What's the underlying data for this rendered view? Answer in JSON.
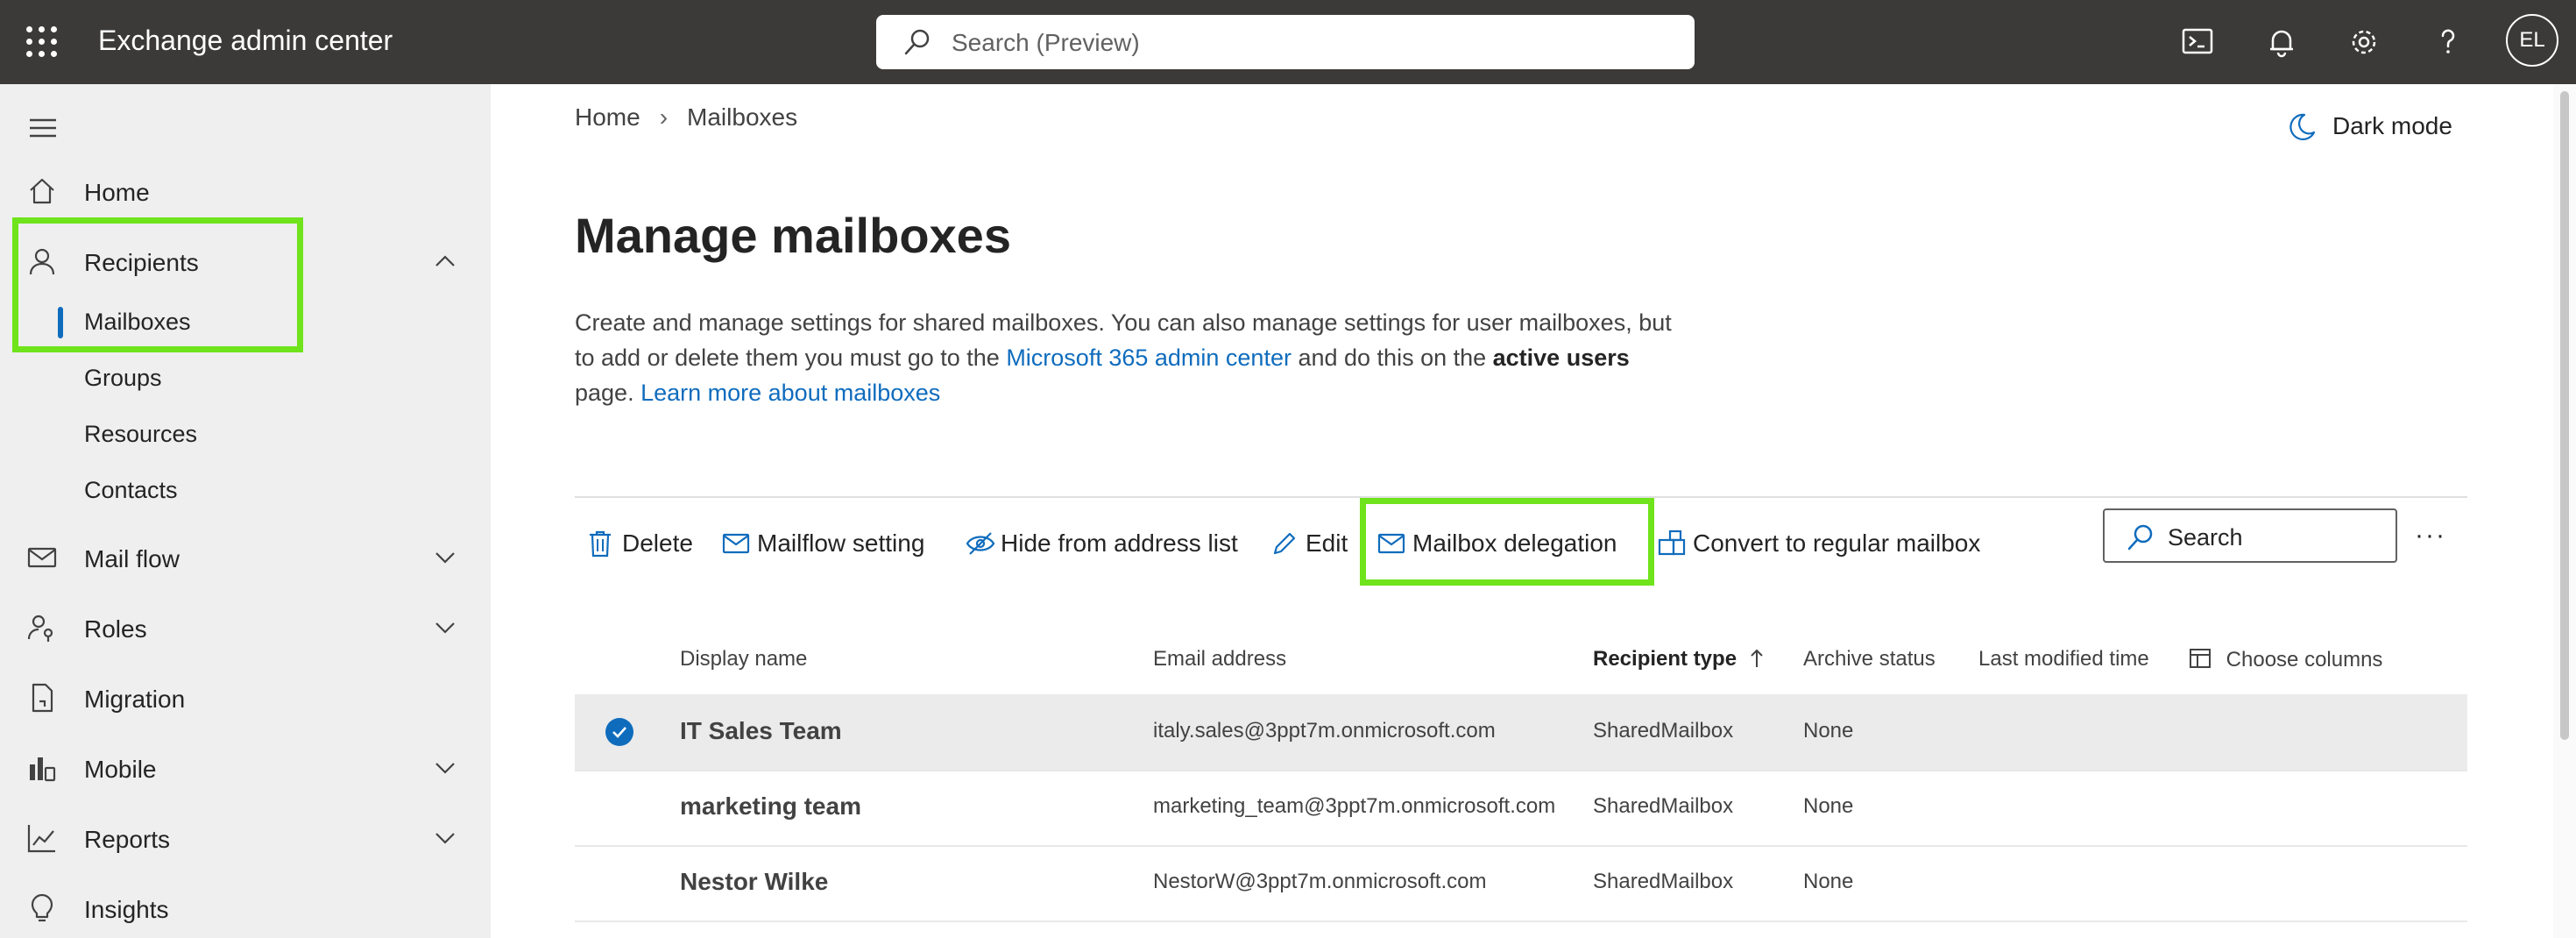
{
  "header": {
    "app_title": "Exchange admin center",
    "search_placeholder": "Search (Preview)",
    "avatar_initials": "EL"
  },
  "sidebar": {
    "items": [
      {
        "label": "Home"
      },
      {
        "label": "Recipients"
      },
      {
        "label": "Mail flow"
      },
      {
        "label": "Roles"
      },
      {
        "label": "Migration"
      },
      {
        "label": "Mobile"
      },
      {
        "label": "Reports"
      },
      {
        "label": "Insights"
      }
    ],
    "recipients_sub": [
      "Mailboxes",
      "Groups",
      "Resources",
      "Contacts"
    ]
  },
  "main": {
    "breadcrumb": [
      "Home",
      "Mailboxes"
    ],
    "dark_mode_label": "Dark mode",
    "title": "Manage mailboxes",
    "desc_part1": "Create and manage settings for shared mailboxes. You can also manage settings for user mailboxes, but to add or delete them you must go to the ",
    "desc_link1": "Microsoft 365 admin center",
    "desc_part2": " and do this on the ",
    "desc_bold": "active users",
    "desc_part3": " page. ",
    "desc_link2": "Learn more about mailboxes",
    "commands": {
      "delete": "Delete",
      "mailflow": "Mailflow setting",
      "hide": "Hide from address list",
      "edit": "Edit",
      "delegation": "Mailbox delegation",
      "convert": "Convert to regular mailbox"
    },
    "table_search_placeholder": "Search",
    "more_label": "···",
    "columns": {
      "display_name": "Display name",
      "email": "Email address",
      "recipient_type": "Recipient type",
      "archive": "Archive status",
      "last_modified": "Last modified time",
      "choose": "Choose columns"
    },
    "rows": [
      {
        "name": "IT Sales Team",
        "email": "italy.sales@3ppt7m.onmicrosoft.com",
        "type": "SharedMailbox",
        "archive": "None"
      },
      {
        "name": "marketing team",
        "email": "marketing_team@3ppt7m.onmicrosoft.com",
        "type": "SharedMailbox",
        "archive": "None"
      },
      {
        "name": "Nestor Wilke",
        "email": "NestorW@3ppt7m.onmicrosoft.com",
        "type": "SharedMailbox",
        "archive": "None"
      }
    ]
  },
  "colors": {
    "accent": "#0f6cbd",
    "highlight": "#6fe31b",
    "topbar": "#3b3a39",
    "sidebar": "#efefef"
  }
}
